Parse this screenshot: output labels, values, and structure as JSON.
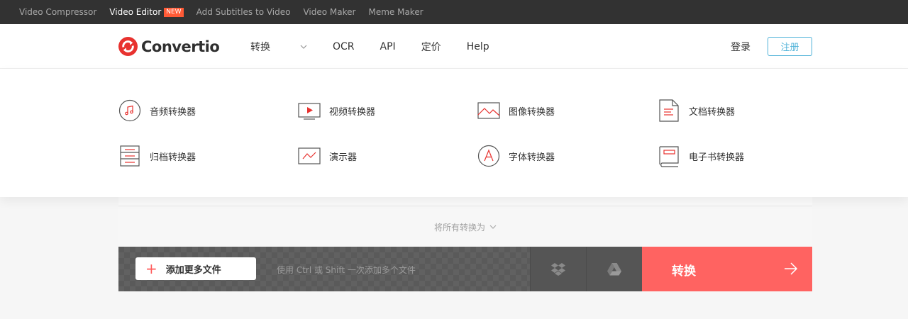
{
  "topbar": {
    "links": [
      {
        "label": "Video Compressor"
      },
      {
        "label": "Video Editor",
        "badge": "NEW"
      },
      {
        "label": "Add Subtitles to Video"
      },
      {
        "label": "Video Maker"
      },
      {
        "label": "Meme Maker"
      }
    ]
  },
  "header": {
    "logo_text": "Convertio",
    "nav": [
      {
        "label": "转换",
        "dropdown": true
      },
      {
        "label": "OCR"
      },
      {
        "label": "API"
      },
      {
        "label": "定价"
      },
      {
        "label": "Help"
      }
    ],
    "login": "登录",
    "signup": "注册"
  },
  "dropdown": {
    "items": [
      {
        "label": "音频转换器",
        "icon": "audio-note-icon"
      },
      {
        "label": "视频转换器",
        "icon": "video-player-icon"
      },
      {
        "label": "图像转换器",
        "icon": "image-icon"
      },
      {
        "label": "文档转换器",
        "icon": "document-icon"
      },
      {
        "label": "归档转换器",
        "icon": "archive-icon"
      },
      {
        "label": "演示器",
        "icon": "presentation-icon"
      },
      {
        "label": "字体转换器",
        "icon": "font-icon"
      },
      {
        "label": "电子书转换器",
        "icon": "ebook-icon"
      }
    ]
  },
  "main": {
    "convert_all": "将所有转换为",
    "add_files": "添加更多文件",
    "hint": "使用 Ctrl 或 Shift 一次添加多个文件",
    "convert_button": "转换"
  },
  "colors": {
    "accent": "#ff6361",
    "signup": "#4fb2d8",
    "topbar": "#323232"
  }
}
